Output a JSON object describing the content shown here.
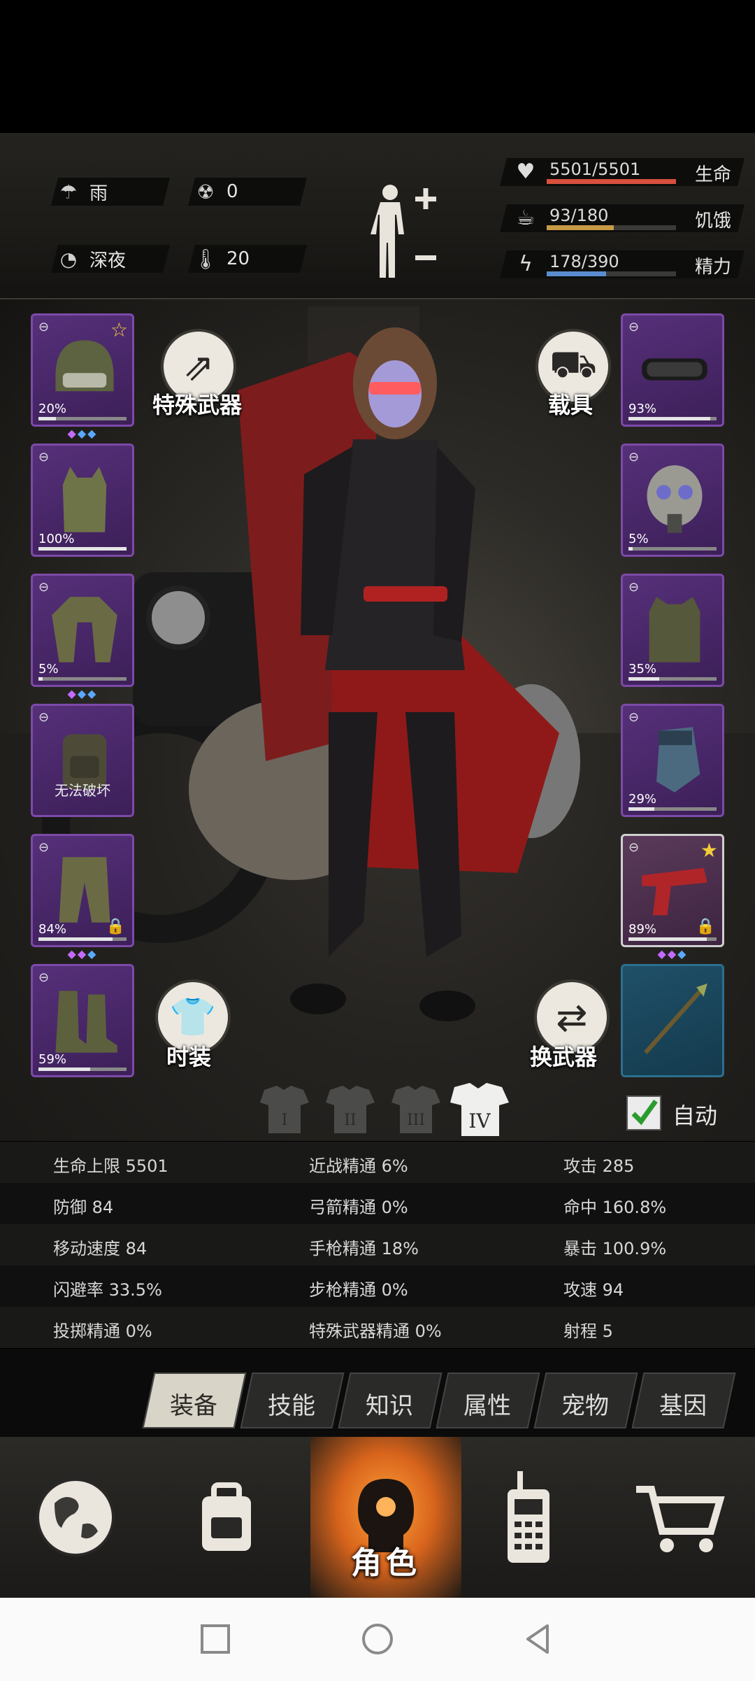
{
  "status": {
    "weather": "雨",
    "radiation": "0",
    "time_of_day": "深夜",
    "temperature": "20",
    "bars": [
      {
        "name": "生命",
        "value": "5501/5501",
        "fraction": 1.0,
        "color": "#d8503e",
        "icon": "heart-pulse-icon"
      },
      {
        "name": "饥饿",
        "value": "93/180",
        "fraction": 0.52,
        "color": "#c79a45",
        "icon": "food-icon"
      },
      {
        "name": "精力",
        "value": "178/390",
        "fraction": 0.46,
        "color": "#5a8ccf",
        "icon": "energy-icon"
      }
    ]
  },
  "left_slots": [
    {
      "name": "helmet",
      "durability": "20%",
      "durability_fraction": 0.2,
      "starred": true,
      "gems": "◆◆◆"
    },
    {
      "name": "body-armor",
      "durability": "100%",
      "durability_fraction": 1.0
    },
    {
      "name": "jacket",
      "durability": "5%",
      "durability_fraction": 0.05,
      "gems": "◆◆◆"
    },
    {
      "name": "backpack",
      "note": "无法破坏"
    },
    {
      "name": "pants",
      "durability": "84%",
      "durability_fraction": 0.84,
      "locked": true,
      "gems": "◆◆◆"
    },
    {
      "name": "boots",
      "durability": "59%",
      "durability_fraction": 0.59
    }
  ],
  "right_slots": [
    {
      "name": "goggles",
      "durability": "93%",
      "durability_fraction": 0.93
    },
    {
      "name": "gas-mask",
      "durability": "5%",
      "durability_fraction": 0.05
    },
    {
      "name": "vest",
      "durability": "35%",
      "durability_fraction": 0.35
    },
    {
      "name": "gloves",
      "durability": "29%",
      "durability_fraction": 0.29
    },
    {
      "name": "pistol",
      "durability": "89%",
      "durability_fraction": 0.89,
      "starred": true,
      "locked": true,
      "gems": "◆◆◆"
    },
    {
      "name": "spear"
    }
  ],
  "buttons": {
    "special_weapon": "特殊武器",
    "vehicle": "载具",
    "outfit": "时装",
    "swap_weapon": "换武器",
    "auto": "自动"
  },
  "outfit_tabs": [
    "I",
    "II",
    "III",
    "IV"
  ],
  "stats": [
    [
      "生命上限 5501",
      "近战精通 6%",
      "攻击 285"
    ],
    [
      "防御 84",
      "弓箭精通 0%",
      "命中 160.8%"
    ],
    [
      "移动速度 84",
      "手枪精通 18%",
      "暴击 100.9%"
    ],
    [
      "闪避率 33.5%",
      "步枪精通 0%",
      "攻速 94"
    ],
    [
      "投掷精通 0%",
      "特殊武器精通 0%",
      "射程 5"
    ]
  ],
  "tabs": [
    "装备",
    "技能",
    "知识",
    "属性",
    "宠物",
    "基因"
  ],
  "active_tab": "装备",
  "nav": {
    "active_label": "角色",
    "items": [
      "globe-icon",
      "backpack-icon",
      "character-icon",
      "radio-icon",
      "cart-icon"
    ]
  }
}
